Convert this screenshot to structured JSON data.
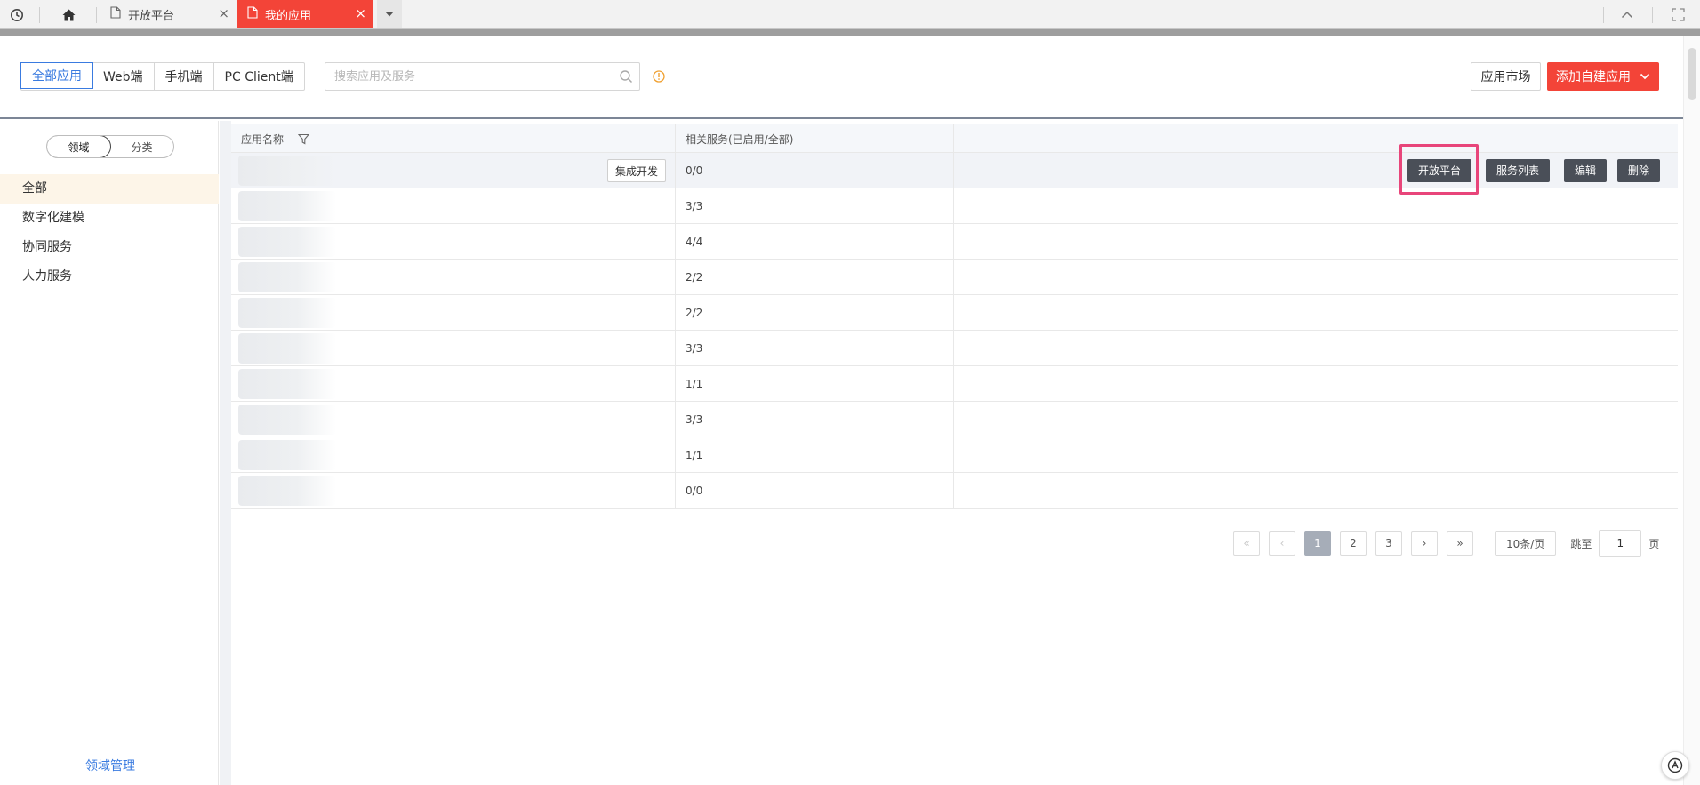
{
  "browser": {
    "tabs": [
      {
        "title": "开放平台",
        "active": false
      },
      {
        "title": "我的应用",
        "active": true
      }
    ],
    "close_glyph": "×"
  },
  "toolbar": {
    "segments": [
      {
        "label": "全部应用",
        "active": true
      },
      {
        "label": "Web端",
        "active": false
      },
      {
        "label": "手机端",
        "active": false
      },
      {
        "label": "PC Client端",
        "active": false
      }
    ],
    "search_placeholder": "搜索应用及服务",
    "market_label": "应用市场",
    "add_label": "添加自建应用"
  },
  "sidebar": {
    "toggle": [
      {
        "label": "领域",
        "active": true
      },
      {
        "label": "分类",
        "active": false
      }
    ],
    "categories": [
      {
        "label": "全部",
        "active": true
      },
      {
        "label": "数字化建模",
        "active": false
      },
      {
        "label": "协同服务",
        "active": false
      },
      {
        "label": "人力服务",
        "active": false
      }
    ],
    "manage_label": "领域管理"
  },
  "table": {
    "headers": {
      "name": "应用名称",
      "services": "相关服务(已启用/全部)",
      "ops": ""
    },
    "integrate_label": "集成开发",
    "ops": {
      "open_platform": "开放平台",
      "service_list": "服务列表",
      "edit": "编辑",
      "delete": "删除"
    },
    "rows": [
      {
        "services": "0/0"
      },
      {
        "services": "3/3"
      },
      {
        "services": "4/4"
      },
      {
        "services": "2/2"
      },
      {
        "services": "2/2"
      },
      {
        "services": "3/3"
      },
      {
        "services": "1/1"
      },
      {
        "services": "3/3"
      },
      {
        "services": "1/1"
      },
      {
        "services": "0/0"
      }
    ]
  },
  "pagination": {
    "first": "«",
    "prev": "‹",
    "pages": [
      "1",
      "2",
      "3"
    ],
    "current": "1",
    "next": "›",
    "last": "»",
    "page_size": "10条/页",
    "jump_label": "跳至",
    "jump_value": "1",
    "jump_unit": "页"
  },
  "colors": {
    "accent_red": "#f34438",
    "link_blue": "#3a7be0",
    "highlight_pink": "#e8457a",
    "dark_button": "#4a4f58"
  },
  "icons": [
    "history-icon",
    "home-icon",
    "document-icon",
    "dropdown-icon",
    "collapse-icon",
    "fullscreen-icon",
    "search-icon",
    "info-icon",
    "chevron-down-icon",
    "filter-icon",
    "help-icon"
  ]
}
